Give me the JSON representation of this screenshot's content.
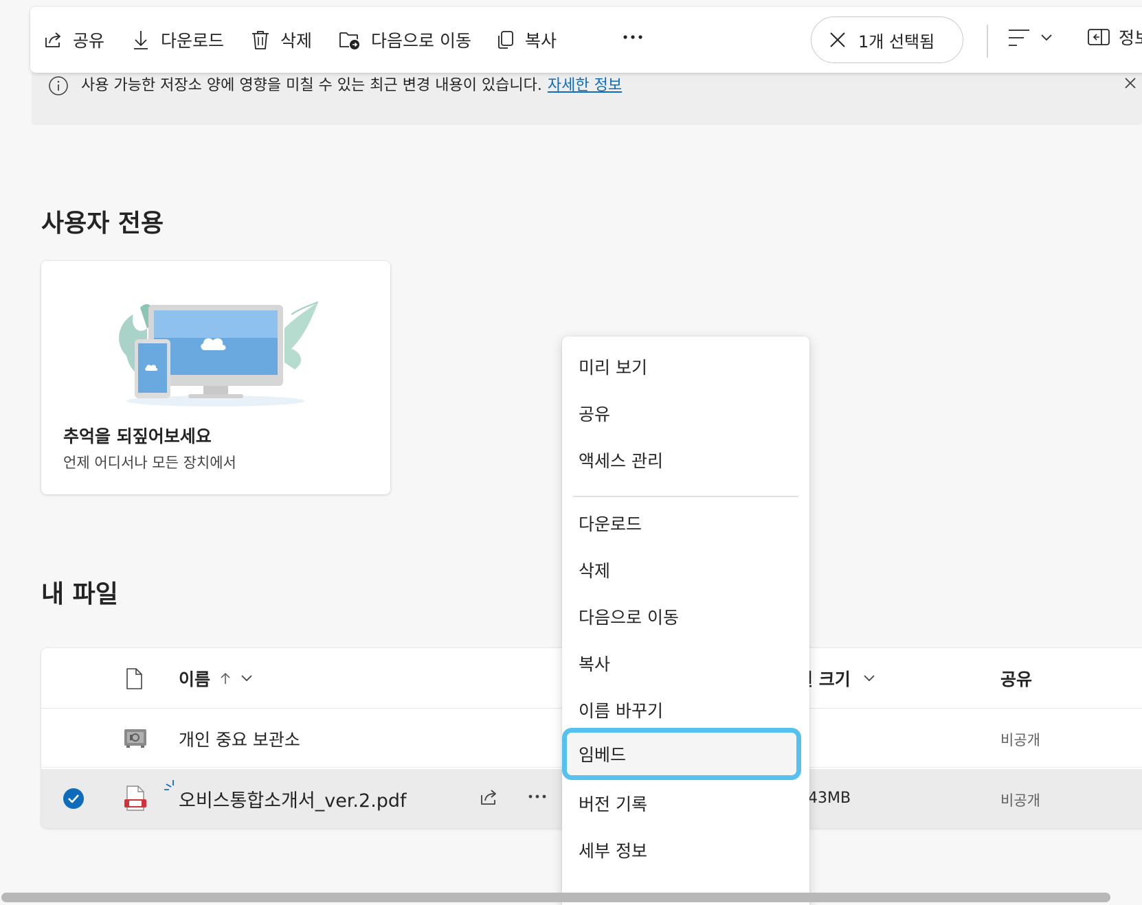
{
  "toolbar": {
    "share": "공유",
    "download": "다운로드",
    "delete": "삭제",
    "move_to": "다음으로 이동",
    "copy": "복사",
    "selected": "1개 선택됨",
    "info": "정보"
  },
  "banner": {
    "message": "사용 가능한 저장소 양에 영향을 미칠 수 있는 최근 변경 내용이 있습니다.",
    "link": "자세한 정보"
  },
  "sections": {
    "personal": "사용자 전용",
    "my_files": "내 파일"
  },
  "promo": {
    "title": "추억을 되짚어보세요",
    "subtitle": "언제 어디서나 모든 장치에서"
  },
  "table": {
    "col_name": "이름",
    "col_size": "일 크기",
    "col_share": "공유",
    "rows": [
      {
        "name": "개인 중요 보관소",
        "size": "",
        "sharing": "비공개",
        "icon": "vault-icon",
        "selected": false
      },
      {
        "name": "오비스통합소개서_ver.2.pdf",
        "size": "43MB",
        "sharing": "비공개",
        "icon": "pdf-file-icon",
        "selected": true
      }
    ]
  },
  "context_menu": {
    "items": [
      "미리 보기",
      "공유",
      "액세스 관리",
      "다운로드",
      "삭제",
      "다음으로 이동",
      "복사",
      "이름 바꾸기",
      "임베드",
      "버전 기록",
      "세부 정보"
    ],
    "highlighted": "임베드"
  },
  "colors": {
    "accent": "#0f6cbd",
    "highlight_ring": "#56c1ef",
    "selected_row": "#ebebeb"
  }
}
